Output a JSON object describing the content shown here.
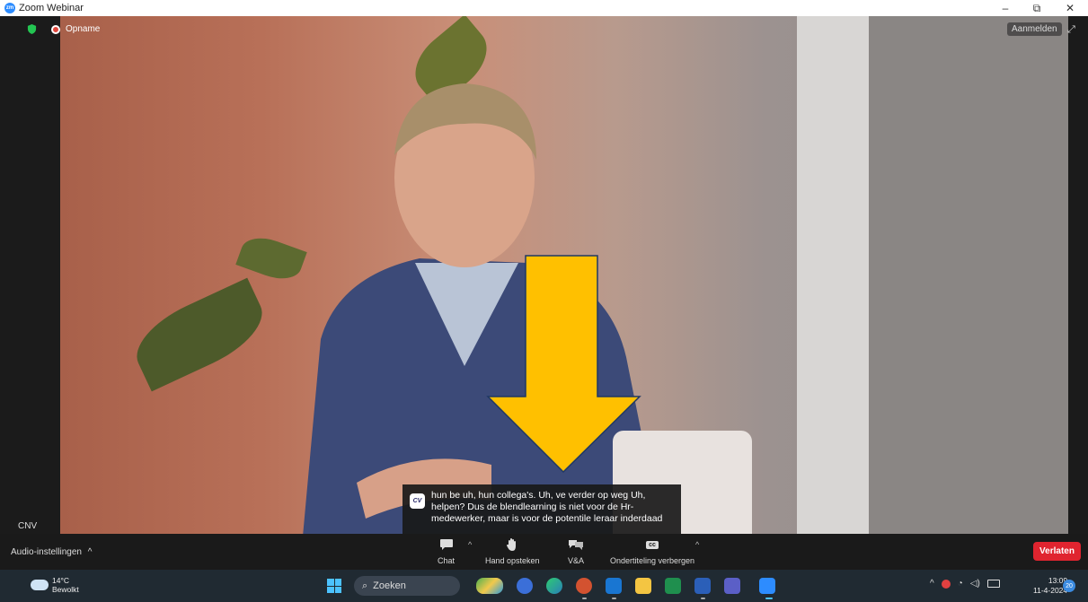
{
  "window": {
    "title": "Zoom Webinar",
    "app_icon_text": "zm",
    "minimize": "–",
    "maximize": "⧉",
    "close": "✕"
  },
  "status": {
    "recording_label": "Opname"
  },
  "signin_label": "Aanmelden",
  "speaker_label": "CNV",
  "caption": {
    "badge": "CV",
    "text": "hun be uh, hun collega's. Uh, ve verder op weg Uh, helpen? Dus de blendlearning is niet voor de Hr-medewerker, maar is voor de potentile leraar inderdaad"
  },
  "toolbar": {
    "audio_settings": "Audio-instellingen",
    "caret": "^",
    "chat": "Chat",
    "raise_hand": "Hand opsteken",
    "qa": "V&A",
    "cc_badge": "cc",
    "hide_captions": "Ondertiteling verbergen",
    "leave": "Verlaten"
  },
  "taskbar": {
    "temperature": "14°C",
    "weather": "Bewolkt",
    "search_placeholder": "Zoeken",
    "time": "13:09",
    "date": "11-4-2024",
    "notification_count": "20"
  },
  "colors": {
    "leave_red": "#e0242f",
    "arrow_yellow": "#ffc000",
    "taskbar": "#202a32"
  }
}
